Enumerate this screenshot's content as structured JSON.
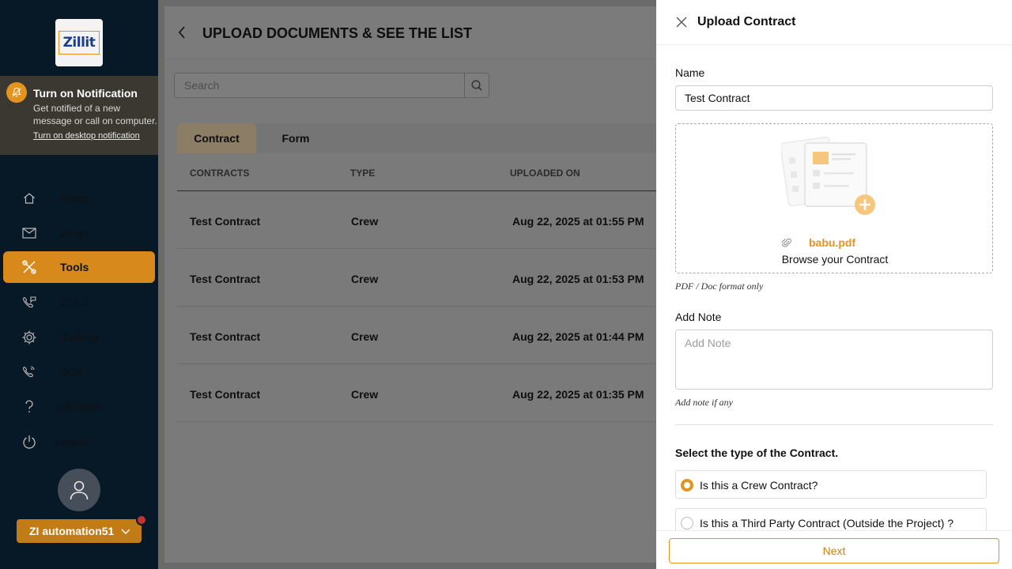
{
  "sidebar": {
    "logo_text": "Zillit",
    "notification": {
      "title": "Turn on Notification",
      "text": "Get notified of a new message or call on computer.",
      "link": "Turn on desktop notification"
    },
    "items": [
      {
        "label": "Home",
        "icon": "home-icon"
      },
      {
        "label": "Email",
        "icon": "mail-icon"
      },
      {
        "label": "Tools",
        "icon": "tools-icon",
        "active": true
      },
      {
        "label": "C & C",
        "icon": "phone-chat-icon"
      },
      {
        "label": "Settings",
        "icon": "gear-icon"
      },
      {
        "label": "SOS",
        "icon": "phone-alert-icon"
      },
      {
        "label": "Zillit Help",
        "icon": "question-icon"
      },
      {
        "label": "Logout",
        "icon": "power-icon"
      }
    ],
    "user_label": "ZI automation51"
  },
  "main": {
    "title": "UPLOAD DOCUMENTS & SEE THE LIST",
    "search_placeholder": "Search",
    "tabs": [
      {
        "label": "Contract",
        "active": true
      },
      {
        "label": "Form"
      }
    ],
    "columns": [
      "CONTRACTS",
      "TYPE",
      "UPLOADED ON"
    ],
    "rows": [
      [
        "Test Contract",
        "Crew",
        "Aug 22, 2025 at 01:55 PM"
      ],
      [
        "Test Contract",
        "Crew",
        "Aug 22, 2025 at 01:53 PM"
      ],
      [
        "Test Contract",
        "Crew",
        "Aug 22, 2025 at 01:44 PM"
      ],
      [
        "Test Contract",
        "Crew",
        "Aug 22, 2025 at 01:35 PM"
      ]
    ]
  },
  "drawer": {
    "title": "Upload Contract",
    "name_label": "Name",
    "name_value": "Test Contract",
    "file_name": "babu.pdf",
    "browse_text": "Browse your Contract",
    "format_hint": "PDF / Doc format only",
    "note_label": "Add Note",
    "note_placeholder": "Add Note",
    "note_hint": "Add note if any",
    "type_question": "Select the type of the Contract.",
    "options": [
      {
        "label": "Is this a Crew Contract?",
        "checked": true
      },
      {
        "label": "Is this a Third Party Contract (Outside the Project) ?",
        "checked": false
      }
    ],
    "next_label": "Next"
  },
  "colors": {
    "accent": "#e3941f",
    "sidebar_bg": "#071827",
    "active_nav": "#d7891c"
  }
}
